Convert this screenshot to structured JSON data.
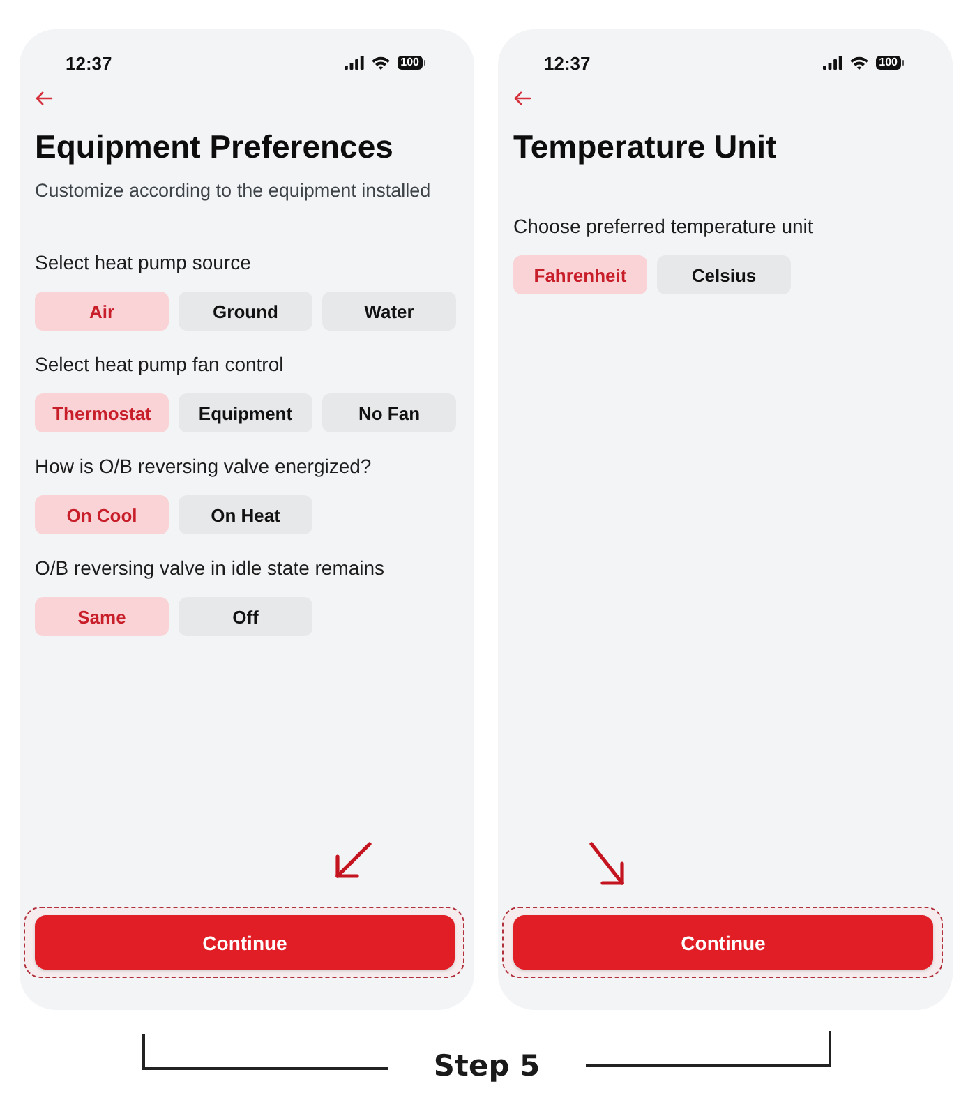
{
  "screens": [
    {
      "status_bar": {
        "time": "12:37",
        "battery": "100"
      },
      "title": "Equipment Preferences",
      "subtitle": "Customize according to the equipment installed",
      "questions": [
        {
          "label": "Select heat pump source",
          "options": [
            {
              "label": "Air",
              "selected": true
            },
            {
              "label": "Ground",
              "selected": false
            },
            {
              "label": "Water",
              "selected": false
            }
          ]
        },
        {
          "label": "Select heat pump fan control",
          "options": [
            {
              "label": "Thermostat",
              "selected": true
            },
            {
              "label": "Equipment",
              "selected": false
            },
            {
              "label": "No Fan",
              "selected": false
            }
          ]
        },
        {
          "label": "How is O/B reversing valve energized?",
          "options": [
            {
              "label": "On Cool",
              "selected": true
            },
            {
              "label": "On Heat",
              "selected": false
            }
          ]
        },
        {
          "label": "O/B reversing valve in idle state remains",
          "options": [
            {
              "label": "Same",
              "selected": true
            },
            {
              "label": "Off",
              "selected": false
            }
          ]
        }
      ],
      "annotation_arrow": {
        "kind": "southwest"
      },
      "continue_button": {
        "label": "Continue",
        "highlighted": true
      }
    },
    {
      "status_bar": {
        "time": "12:37",
        "battery": "100"
      },
      "title": "Temperature Unit",
      "questions": [
        {
          "label": "Choose preferred temperature unit",
          "options": [
            {
              "label": "Fahrenheit",
              "selected": true
            },
            {
              "label": "Celsius",
              "selected": false
            }
          ]
        }
      ],
      "annotation_arrow": {
        "kind": "southeast"
      },
      "continue_button": {
        "label": "Continue",
        "highlighted": true
      }
    }
  ],
  "step_caption": "Step 5"
}
